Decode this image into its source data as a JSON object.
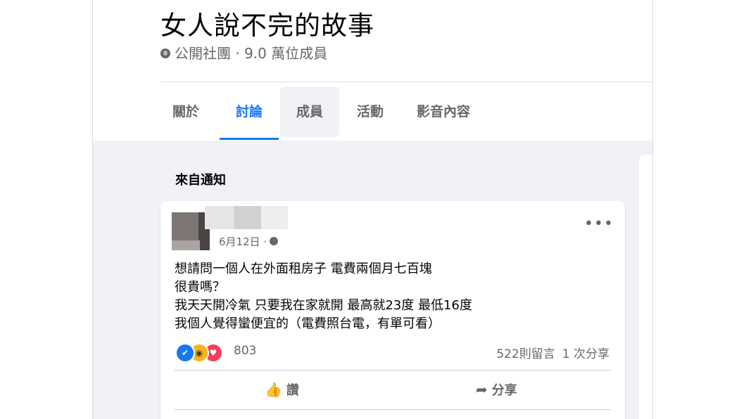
{
  "group": {
    "title": "女人說不完的故事",
    "meta": "公開社團 · 9.0 萬位成員"
  },
  "tabs": [
    {
      "label": "關於"
    },
    {
      "label": "討論"
    },
    {
      "label": "成員"
    },
    {
      "label": "活動"
    },
    {
      "label": "影音內容"
    }
  ],
  "feed": {
    "section_label": "來自通知"
  },
  "post": {
    "timestamp": "6月12日 ·",
    "text_lines": [
      "想請問一個人在外面租房子 電費兩個月七百塊",
      "很貴嗎？",
      "我天天開冷氣 只要我在家就開 最高就23度 最低16度",
      "我個人覺得蠻便宜的（電費照台電，有單可看）"
    ],
    "reaction_count": "803",
    "comments": "522則留言",
    "shares": "1 次分享",
    "like_label": "讚",
    "share_label": "分享",
    "more_icon": "•••",
    "like_icon": "👍",
    "share_icon": "➦"
  },
  "colors": {
    "accent": "#1877f2",
    "secondary_text": "#65676b",
    "feed_background": "#f0f2f5"
  }
}
